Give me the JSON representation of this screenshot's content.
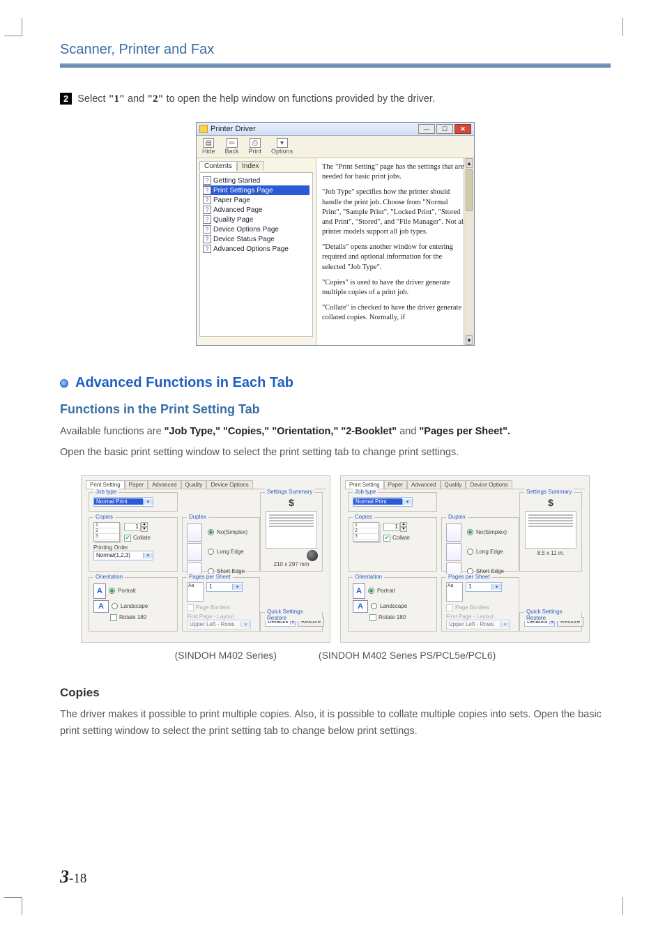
{
  "chapter_title": "Scanner, Printer and Fax",
  "step": {
    "badge": "2",
    "before": "Select ",
    "q1": "\"1\"",
    "mid": " and ",
    "q2": "\"2\"",
    "after": " to open the help window on functions provided by the driver."
  },
  "help_window": {
    "title": "Printer Driver",
    "toolbar": {
      "hide": "Hide",
      "back": "Back",
      "print": "Print",
      "options": "Options"
    },
    "tabs": {
      "contents": "Contents",
      "index": "Index"
    },
    "tree": [
      "Getting Started",
      "Print Settings Page",
      "Paper Page",
      "Advanced Page",
      "Quality Page",
      "Device Options Page",
      "Device Status Page",
      "Advanced Options Page"
    ],
    "paragraphs": [
      "The \"Print Setting\" page has the settings that are needed for basic print jobs.",
      "\"Job Type\" specifies how the printer should handle the print job. Choose from \"Normal Print\", \"Sample Print\", \"Locked Print\", \"Stored and Print\", \"Stored\", and \"File Manager\". Not all printer models support all job types.",
      "\"Details\" opens another window for entering required and optional information for the selected \"Job Type\".",
      "\"Copies\" is used to have the driver generate multiple copies of a print job.",
      "\"Collate\" is checked to have the driver generate collated copies. Normally, if"
    ]
  },
  "advanced_heading": "Advanced Functions in Each Tab",
  "functions_heading": "Functions in the Print Setting Tab",
  "functions_para": {
    "pre": "Available functions are ",
    "f1": "\"Job Type,\" \"Copies,\" \"Orientation,\" \"2-Booklet\"",
    "mid": " and ",
    "f2": "\"Pages per Sheet\".",
    "line2": "Open the basic print setting window to select the print setting tab to change print settings."
  },
  "ps_dialog": {
    "tabs": [
      "Print Setting",
      "Paper",
      "Advanced",
      "Quality",
      "Device Options"
    ],
    "jobtype_title": "Job type",
    "jobtype_value": "Normal Print",
    "copies_title": "Copies",
    "copies_value": "1",
    "collate": "Collate",
    "printing_order_label": "Printing Order",
    "printing_order_value": "Normal(1,2,3)",
    "duplex_title": "Duplex",
    "duplex_no": "No(Simplex)",
    "duplex_long": "Long Edge",
    "duplex_short": "Short Edge",
    "orientation_title": "Orientation",
    "portrait": "Portrait",
    "landscape": "Landscape",
    "rotate": "Rotate 180",
    "pps_title": "Pages per Sheet",
    "pps_value": "1",
    "page_borders": "Page Borders",
    "first_page_layout": "First Page - Layout",
    "fpl_value": "Upper Left - Rows",
    "summary_title": "Settings Summary",
    "size_left": "210 x 297 mm",
    "size_right": "8.5 x 11 in.",
    "qsr_title": "Quick Settings Restore",
    "defaults": "Defaults",
    "restore": "Restore",
    "dollar": "$"
  },
  "ps_captions": {
    "left": "(SINDOH M402 Series)",
    "right": "(SINDOH M402 Series PS/PCL5e/PCL6)"
  },
  "copies_heading": "Copies",
  "copies_para": "The driver makes it possible to print multiple copies. Also, it is possible to collate multiple copies into sets. Open the basic print setting window to select the print setting tab to change below print settings.",
  "page_number": {
    "big": "3",
    "small": "-18"
  }
}
